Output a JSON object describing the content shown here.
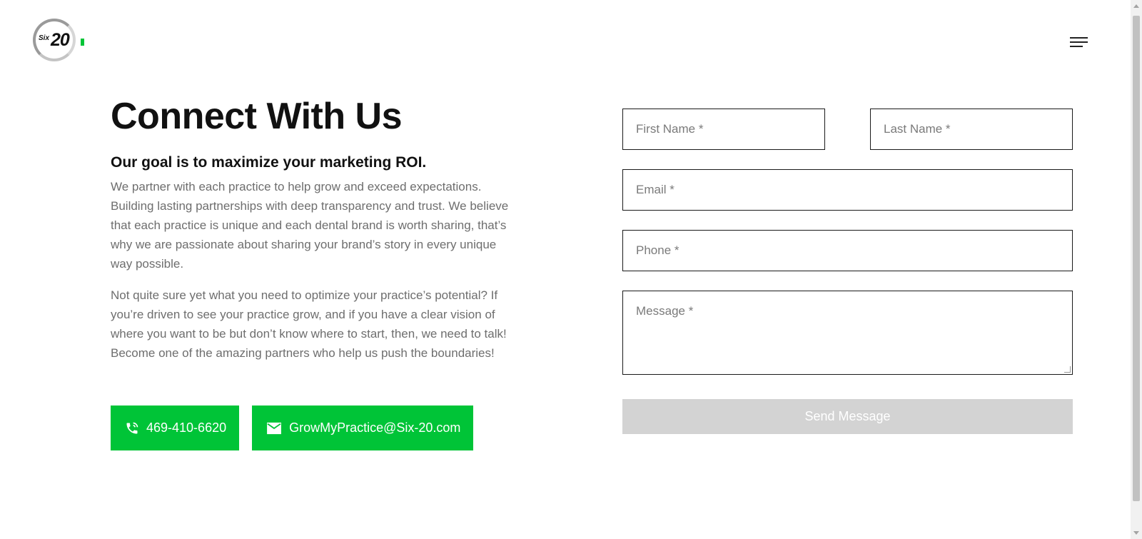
{
  "header": {
    "logo": {
      "text_small": "Six",
      "text_large": "20",
      "accent": "#00c437"
    },
    "menu_icon": "hamburger-menu-icon"
  },
  "intro": {
    "title": "Connect With Us",
    "subtitle": "Our goal is to maximize your marketing ROI.",
    "paragraphs": [
      "We partner with each practice to help grow and exceed expectations. Building lasting partnerships with deep transparency and trust. We believe that each practice is unique and each dental brand is worth sharing, that’s why we are passionate about sharing your brand’s story in every unique way possible.",
      "Not quite sure yet what you need to optimize your practice’s potential? If you’re driven to see your practice grow, and if you have a clear vision of where you want to be but don’t know where to start, then, we need to talk! Become one of the amazing partners who help us push the boundaries!"
    ]
  },
  "contact": {
    "phone": {
      "label": "469-410-6620",
      "icon": "phone-icon"
    },
    "email": {
      "label": "GrowMyPractice@Six-20.com",
      "icon": "mail-icon"
    },
    "accent_color": "#00c437"
  },
  "form": {
    "first_name_placeholder": "First Name *",
    "last_name_placeholder": "Last Name *",
    "email_placeholder": "Email *",
    "phone_placeholder": "Phone *",
    "message_placeholder": "Message *",
    "submit_label": "Send Message",
    "submit_color": "#d3d3d3"
  }
}
